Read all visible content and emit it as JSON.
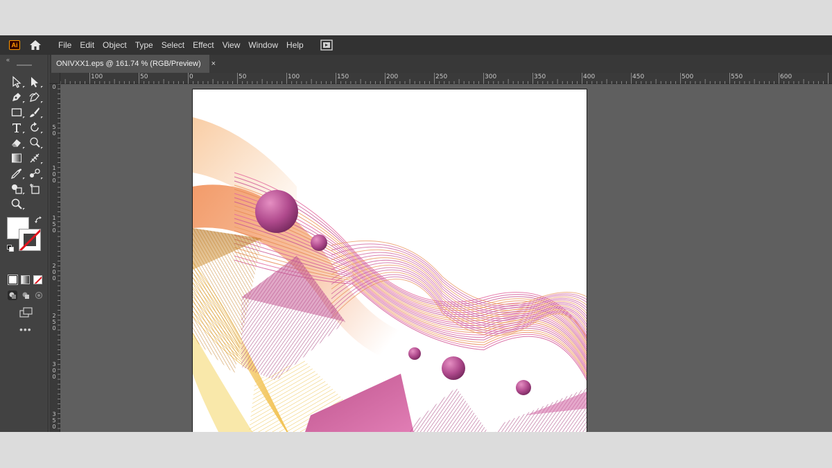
{
  "app": {
    "logo_text": "Ai"
  },
  "menu": {
    "items": [
      "File",
      "Edit",
      "Object",
      "Type",
      "Select",
      "Effect",
      "View",
      "Window",
      "Help"
    ]
  },
  "document_tab": {
    "label": "ONIVXX1.eps @ 161.74 % (RGB/Preview)",
    "close_glyph": "×"
  },
  "rulers": {
    "horizontal_labels": [
      "100",
      "50",
      "0",
      "50",
      "100",
      "150",
      "200",
      "250",
      "300",
      "350",
      "400",
      "450",
      "500",
      "550",
      "600"
    ],
    "vertical_labels": [
      "0",
      "5\n0",
      "1\n0\n0",
      "1\n5\n0",
      "2\n0\n0",
      "2\n5\n0",
      "3\n0\n0",
      "3\n5\n0"
    ]
  },
  "toolbar": {
    "collapse_glyph": "«",
    "more_glyph": "•••",
    "fill_color": "#ffffff",
    "stroke_color": "none"
  },
  "colors": {
    "app_bg": "#535353",
    "menubar": "#323232",
    "toolbar": "#424242",
    "artboard": "#ffffff",
    "accent_orange": "#ff9a00",
    "art_magenta": "#b84c93",
    "art_orange": "#f4a06c",
    "art_yellow": "#f2d15a"
  },
  "icons": [
    "home-icon",
    "arrange-documents-icon",
    "selection-tool-icon",
    "direct-selection-tool-icon",
    "pen-tool-icon",
    "curvature-tool-icon",
    "rectangle-tool-icon",
    "paintbrush-tool-icon",
    "type-tool-icon",
    "rotate-tool-icon",
    "eraser-tool-icon",
    "warp-tool-icon",
    "gradient-tool-icon",
    "mesh-tool-icon",
    "eyedropper-tool-icon",
    "blend-tool-icon",
    "shape-builder-tool-icon",
    "artboard-tool-icon",
    "zoom-tool-icon",
    "swap-fill-stroke-icon",
    "default-colors-icon"
  ]
}
